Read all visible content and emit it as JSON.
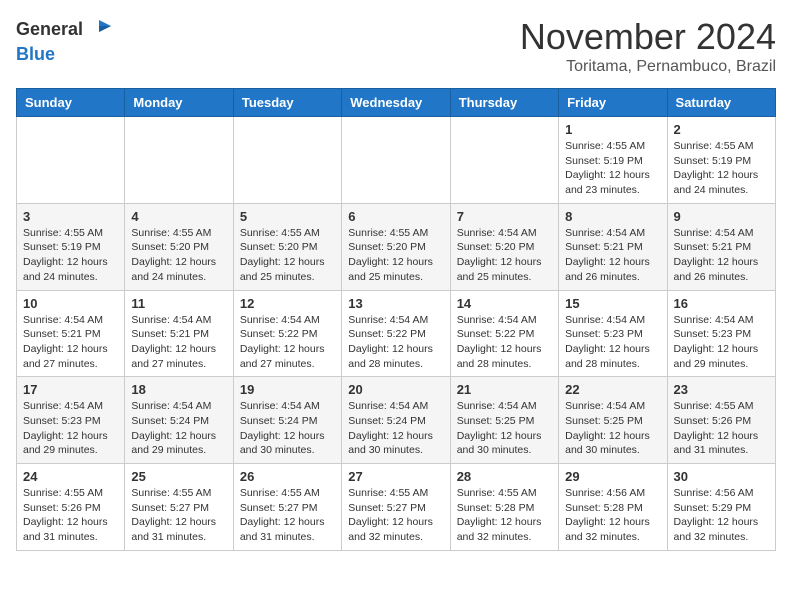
{
  "logo": {
    "general": "General",
    "blue": "Blue"
  },
  "header": {
    "month": "November 2024",
    "location": "Toritama, Pernambuco, Brazil"
  },
  "weekdays": [
    "Sunday",
    "Monday",
    "Tuesday",
    "Wednesday",
    "Thursday",
    "Friday",
    "Saturday"
  ],
  "weeks": [
    [
      {
        "day": "",
        "info": ""
      },
      {
        "day": "",
        "info": ""
      },
      {
        "day": "",
        "info": ""
      },
      {
        "day": "",
        "info": ""
      },
      {
        "day": "",
        "info": ""
      },
      {
        "day": "1",
        "info": "Sunrise: 4:55 AM\nSunset: 5:19 PM\nDaylight: 12 hours and 23 minutes."
      },
      {
        "day": "2",
        "info": "Sunrise: 4:55 AM\nSunset: 5:19 PM\nDaylight: 12 hours and 24 minutes."
      }
    ],
    [
      {
        "day": "3",
        "info": "Sunrise: 4:55 AM\nSunset: 5:19 PM\nDaylight: 12 hours and 24 minutes."
      },
      {
        "day": "4",
        "info": "Sunrise: 4:55 AM\nSunset: 5:20 PM\nDaylight: 12 hours and 24 minutes."
      },
      {
        "day": "5",
        "info": "Sunrise: 4:55 AM\nSunset: 5:20 PM\nDaylight: 12 hours and 25 minutes."
      },
      {
        "day": "6",
        "info": "Sunrise: 4:55 AM\nSunset: 5:20 PM\nDaylight: 12 hours and 25 minutes."
      },
      {
        "day": "7",
        "info": "Sunrise: 4:54 AM\nSunset: 5:20 PM\nDaylight: 12 hours and 25 minutes."
      },
      {
        "day": "8",
        "info": "Sunrise: 4:54 AM\nSunset: 5:21 PM\nDaylight: 12 hours and 26 minutes."
      },
      {
        "day": "9",
        "info": "Sunrise: 4:54 AM\nSunset: 5:21 PM\nDaylight: 12 hours and 26 minutes."
      }
    ],
    [
      {
        "day": "10",
        "info": "Sunrise: 4:54 AM\nSunset: 5:21 PM\nDaylight: 12 hours and 27 minutes."
      },
      {
        "day": "11",
        "info": "Sunrise: 4:54 AM\nSunset: 5:21 PM\nDaylight: 12 hours and 27 minutes."
      },
      {
        "day": "12",
        "info": "Sunrise: 4:54 AM\nSunset: 5:22 PM\nDaylight: 12 hours and 27 minutes."
      },
      {
        "day": "13",
        "info": "Sunrise: 4:54 AM\nSunset: 5:22 PM\nDaylight: 12 hours and 28 minutes."
      },
      {
        "day": "14",
        "info": "Sunrise: 4:54 AM\nSunset: 5:22 PM\nDaylight: 12 hours and 28 minutes."
      },
      {
        "day": "15",
        "info": "Sunrise: 4:54 AM\nSunset: 5:23 PM\nDaylight: 12 hours and 28 minutes."
      },
      {
        "day": "16",
        "info": "Sunrise: 4:54 AM\nSunset: 5:23 PM\nDaylight: 12 hours and 29 minutes."
      }
    ],
    [
      {
        "day": "17",
        "info": "Sunrise: 4:54 AM\nSunset: 5:23 PM\nDaylight: 12 hours and 29 minutes."
      },
      {
        "day": "18",
        "info": "Sunrise: 4:54 AM\nSunset: 5:24 PM\nDaylight: 12 hours and 29 minutes."
      },
      {
        "day": "19",
        "info": "Sunrise: 4:54 AM\nSunset: 5:24 PM\nDaylight: 12 hours and 30 minutes."
      },
      {
        "day": "20",
        "info": "Sunrise: 4:54 AM\nSunset: 5:24 PM\nDaylight: 12 hours and 30 minutes."
      },
      {
        "day": "21",
        "info": "Sunrise: 4:54 AM\nSunset: 5:25 PM\nDaylight: 12 hours and 30 minutes."
      },
      {
        "day": "22",
        "info": "Sunrise: 4:54 AM\nSunset: 5:25 PM\nDaylight: 12 hours and 30 minutes."
      },
      {
        "day": "23",
        "info": "Sunrise: 4:55 AM\nSunset: 5:26 PM\nDaylight: 12 hours and 31 minutes."
      }
    ],
    [
      {
        "day": "24",
        "info": "Sunrise: 4:55 AM\nSunset: 5:26 PM\nDaylight: 12 hours and 31 minutes."
      },
      {
        "day": "25",
        "info": "Sunrise: 4:55 AM\nSunset: 5:27 PM\nDaylight: 12 hours and 31 minutes."
      },
      {
        "day": "26",
        "info": "Sunrise: 4:55 AM\nSunset: 5:27 PM\nDaylight: 12 hours and 31 minutes."
      },
      {
        "day": "27",
        "info": "Sunrise: 4:55 AM\nSunset: 5:27 PM\nDaylight: 12 hours and 32 minutes."
      },
      {
        "day": "28",
        "info": "Sunrise: 4:55 AM\nSunset: 5:28 PM\nDaylight: 12 hours and 32 minutes."
      },
      {
        "day": "29",
        "info": "Sunrise: 4:56 AM\nSunset: 5:28 PM\nDaylight: 12 hours and 32 minutes."
      },
      {
        "day": "30",
        "info": "Sunrise: 4:56 AM\nSunset: 5:29 PM\nDaylight: 12 hours and 32 minutes."
      }
    ]
  ]
}
